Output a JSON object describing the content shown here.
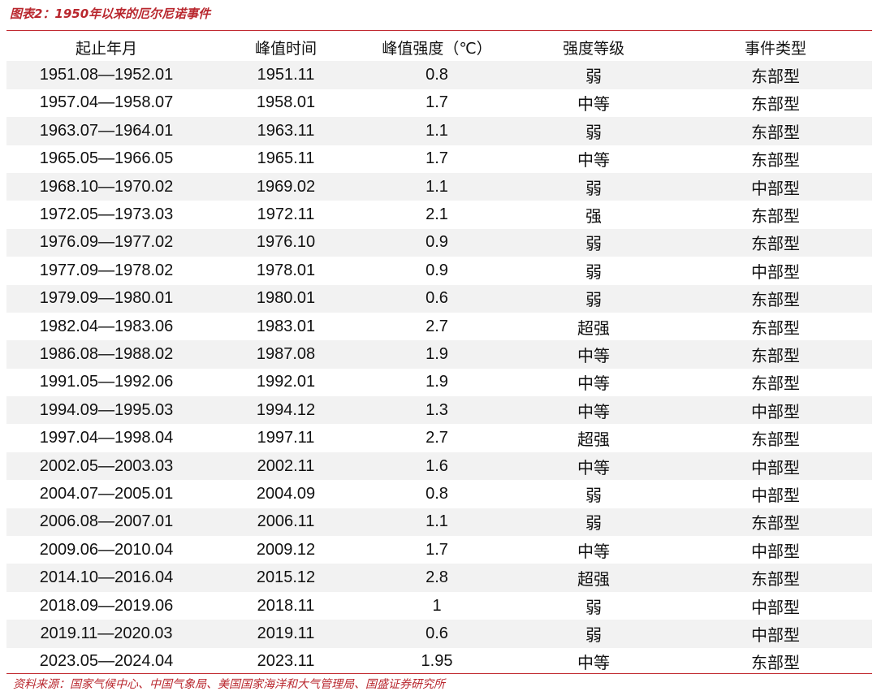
{
  "title": "图表2：1950年以来的厄尔尼诺事件",
  "columns": [
    "起止年月",
    "峰值时间",
    "峰值强度（℃）",
    "强度等级",
    "事件类型"
  ],
  "rows": [
    [
      "1951.08—1952.01",
      "1951.11",
      "0.8",
      "弱",
      "东部型"
    ],
    [
      "1957.04—1958.07",
      "1958.01",
      "1.7",
      "中等",
      "东部型"
    ],
    [
      "1963.07—1964.01",
      "1963.11",
      "1.1",
      "弱",
      "东部型"
    ],
    [
      "1965.05—1966.05",
      "1965.11",
      "1.7",
      "中等",
      "东部型"
    ],
    [
      "1968.10—1970.02",
      "1969.02",
      "1.1",
      "弱",
      "中部型"
    ],
    [
      "1972.05—1973.03",
      "1972.11",
      "2.1",
      "强",
      "东部型"
    ],
    [
      "1976.09—1977.02",
      "1976.10",
      "0.9",
      "弱",
      "东部型"
    ],
    [
      "1977.09—1978.02",
      "1978.01",
      "0.9",
      "弱",
      "中部型"
    ],
    [
      "1979.09—1980.01",
      "1980.01",
      "0.6",
      "弱",
      "东部型"
    ],
    [
      "1982.04—1983.06",
      "1983.01",
      "2.7",
      "超强",
      "东部型"
    ],
    [
      "1986.08—1988.02",
      "1987.08",
      "1.9",
      "中等",
      "东部型"
    ],
    [
      "1991.05—1992.06",
      "1992.01",
      "1.9",
      "中等",
      "东部型"
    ],
    [
      "1994.09—1995.03",
      "1994.12",
      "1.3",
      "中等",
      "中部型"
    ],
    [
      "1997.04—1998.04",
      "1997.11",
      "2.7",
      "超强",
      "东部型"
    ],
    [
      "2002.05—2003.03",
      "2002.11",
      "1.6",
      "中等",
      "中部型"
    ],
    [
      "2004.07—2005.01",
      "2004.09",
      "0.8",
      "弱",
      "中部型"
    ],
    [
      "2006.08—2007.01",
      "2006.11",
      "1.1",
      "弱",
      "东部型"
    ],
    [
      "2009.06—2010.04",
      "2009.12",
      "1.7",
      "中等",
      "中部型"
    ],
    [
      "2014.10—2016.04",
      "2015.12",
      "2.8",
      "超强",
      "东部型"
    ],
    [
      "2018.09—2019.06",
      "2018.11",
      "1",
      "弱",
      "中部型"
    ],
    [
      "2019.11—2020.03",
      "2019.11",
      "0.6",
      "弱",
      "中部型"
    ],
    [
      "2023.05—2024.04",
      "2023.11",
      "1.95",
      "中等",
      "东部型"
    ]
  ],
  "source": "资料来源：国家气候中心、中国气象局、美国国家海洋和大气管理局、国盛证券研究所",
  "colors": {
    "accent": "#c0282f",
    "stripe": "#f2f2f2"
  }
}
